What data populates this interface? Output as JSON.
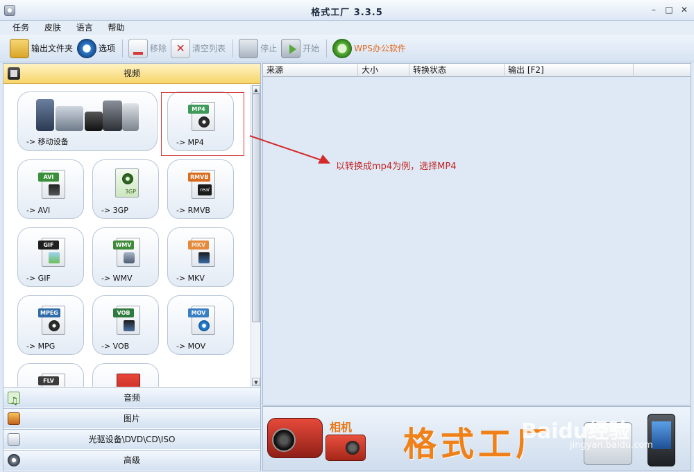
{
  "window": {
    "title": "格式工厂  3.3.5",
    "minimize": "–",
    "maximize": "□",
    "close": "✕"
  },
  "menu": [
    "任务",
    "皮肤",
    "语言",
    "帮助"
  ],
  "toolbar": {
    "output_folder": "输出文件夹",
    "options": "选项",
    "remove": "移除",
    "clear_list": "清空列表",
    "stop": "停止",
    "start": "开始",
    "wps": "WPS办公软件"
  },
  "categories": {
    "video": "视频",
    "audio": "音频",
    "picture": "图片",
    "disc": "光驱设备\\DVD\\CD\\ISO",
    "advanced": "高级"
  },
  "tiles": {
    "mobile": "-> 移动设备",
    "mp4": "-> MP4",
    "avi": "-> AVI",
    "3gp": "-> 3GP",
    "rmvb": "-> RMVB",
    "gif": "-> GIF",
    "wmv": "-> WMV",
    "mkv": "-> MKV",
    "mpg": "-> MPG",
    "vob": "-> VOB",
    "mov": "-> MOV"
  },
  "badges": {
    "mp4": "MP4",
    "avi": "AVI",
    "3gp": "3GP",
    "rmvb": "RMVB",
    "gif": "GIF",
    "wmv": "WMV",
    "mkv": "MKV",
    "mpg": "MPEG",
    "vob": "VOB",
    "mov": "MOV",
    "flv": "FLV",
    "real": "real"
  },
  "table": {
    "columns": [
      "来源",
      "大小",
      "转换状态",
      "输出 [F2]"
    ]
  },
  "annotation": "以转换成mp4为例，选择MP4",
  "banner": {
    "camera_label": "相机",
    "title": "格式工厂",
    "watermark": "Baidu经验",
    "watermark_url": "jingyan.baidu.com"
  },
  "colors": {
    "accent": "#f08018",
    "annotation": "#c42525",
    "selected_header": "#f7d56a"
  }
}
